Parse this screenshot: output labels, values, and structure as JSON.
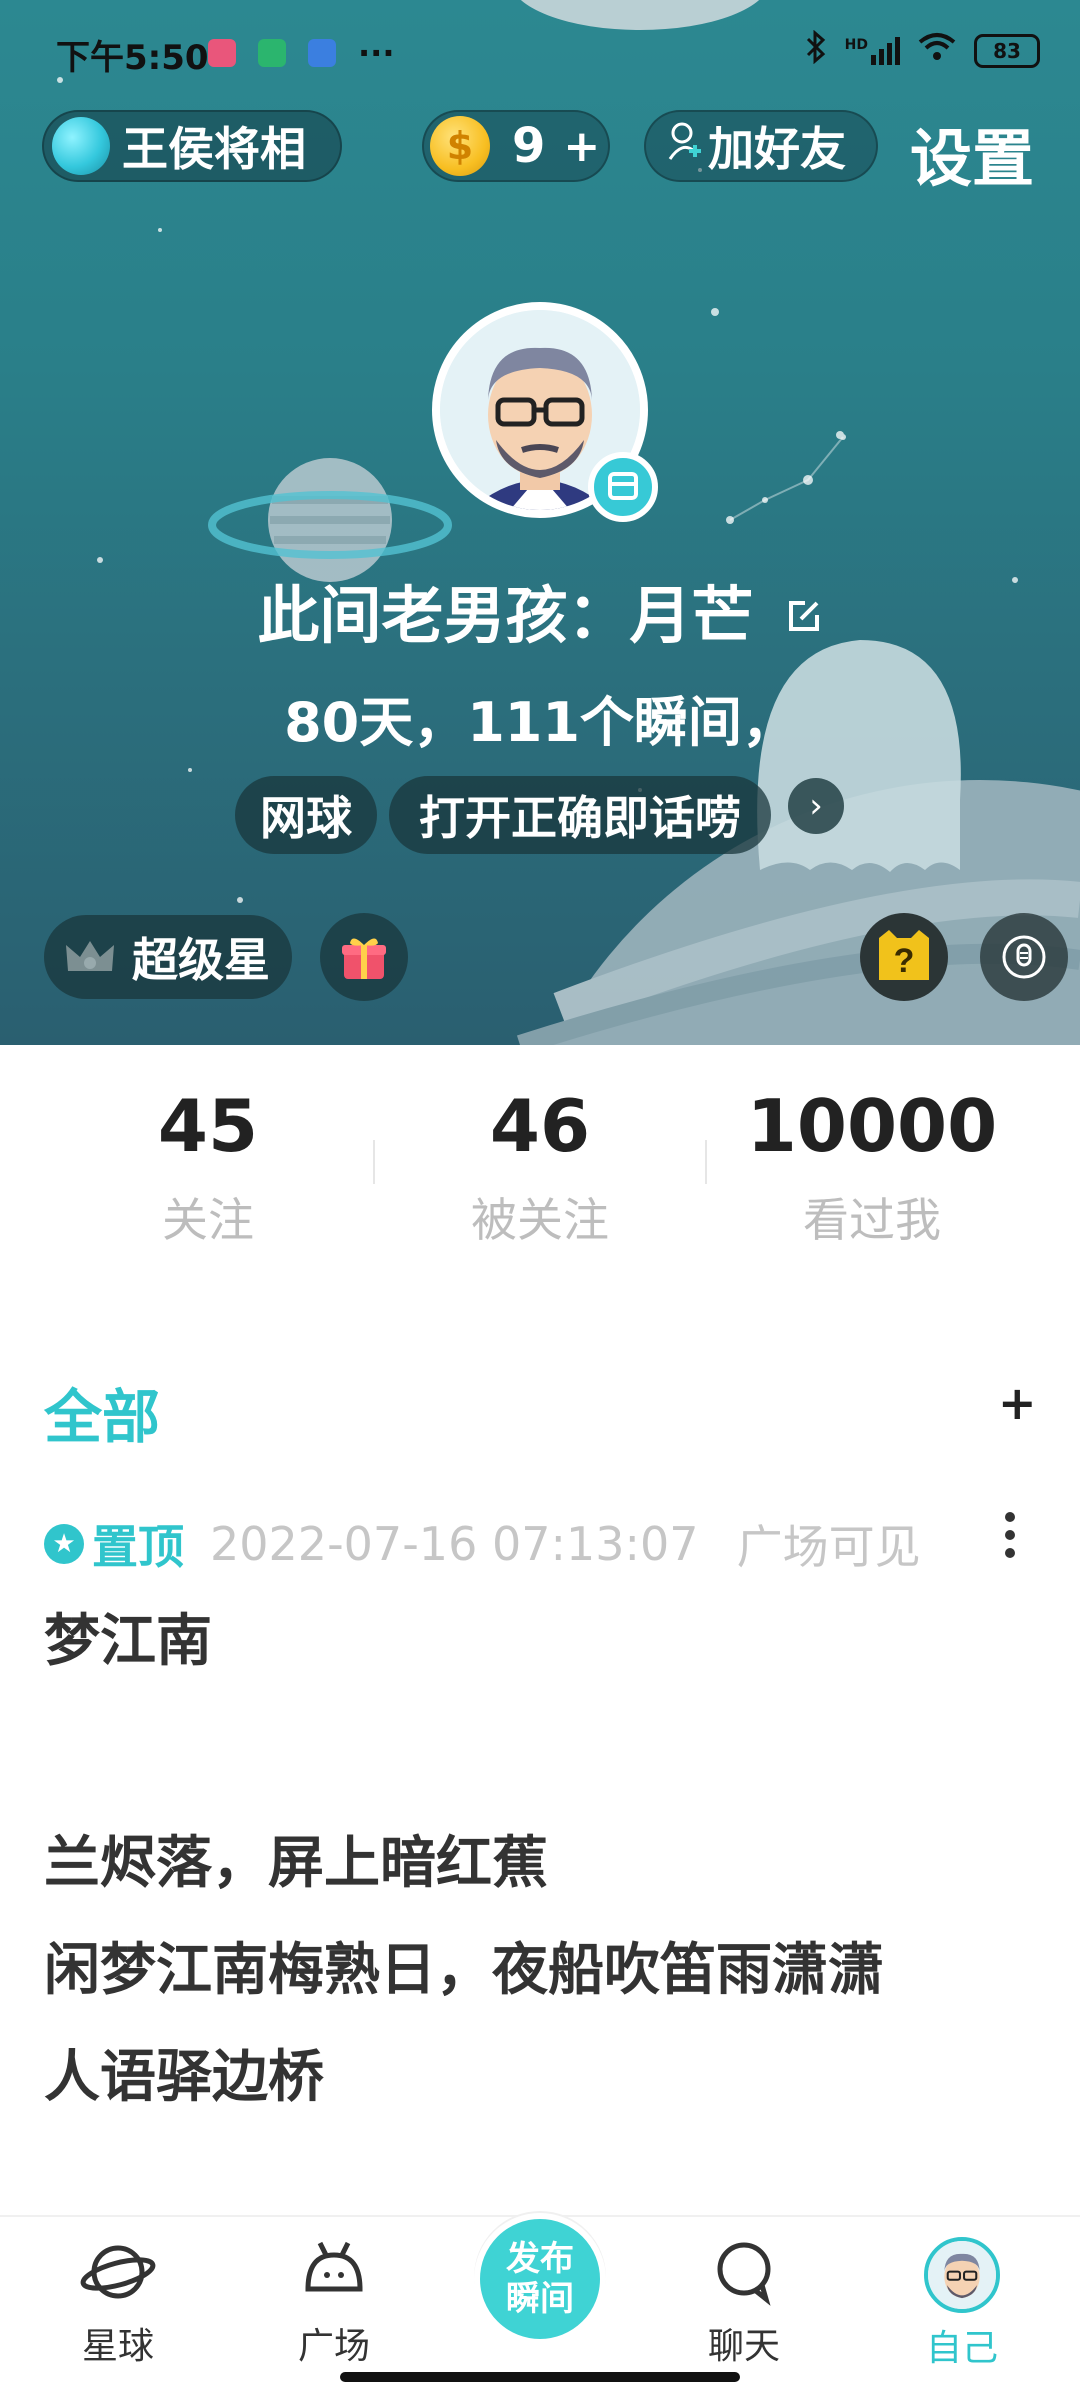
{
  "status_bar": {
    "time": "下午5:50",
    "dots": "···",
    "network": "HD",
    "battery": "83"
  },
  "header": {
    "planet_name": "王侯将相",
    "coin_count": "9",
    "coin_plus": "+",
    "coin_symbol": "$",
    "add_friend": "加好友",
    "settings": "设置"
  },
  "profile": {
    "name": "此间老男孩：月芒",
    "summary": "80天，111个瞬间，",
    "tags": [
      "网球",
      "打开正确即话唠"
    ],
    "vip_label": "超级星"
  },
  "counters": [
    {
      "value": "45",
      "label": "关注"
    },
    {
      "value": "46",
      "label": "被关注"
    },
    {
      "value": "10000",
      "label": "看过我"
    }
  ],
  "feed": {
    "filter": "全部",
    "add": "+",
    "post": {
      "pin_label": "置顶",
      "date": "2022-07-16 07:13:07",
      "visibility": "广场可见",
      "lines": [
        "梦江南",
        "",
        "兰烬落，屏上暗红蕉",
        "闲梦江南梅熟日，夜船吹笛雨潇潇",
        "人语驿边桥"
      ]
    }
  },
  "bottom_nav": {
    "planet": "星球",
    "square": "广场",
    "publish_line1": "发布",
    "publish_line2": "瞬间",
    "chat": "聊天",
    "me": "自己"
  },
  "colors": {
    "accent": "#30c5cc",
    "hero_top": "#2c8891",
    "hero_bottom": "#2a5f70"
  }
}
